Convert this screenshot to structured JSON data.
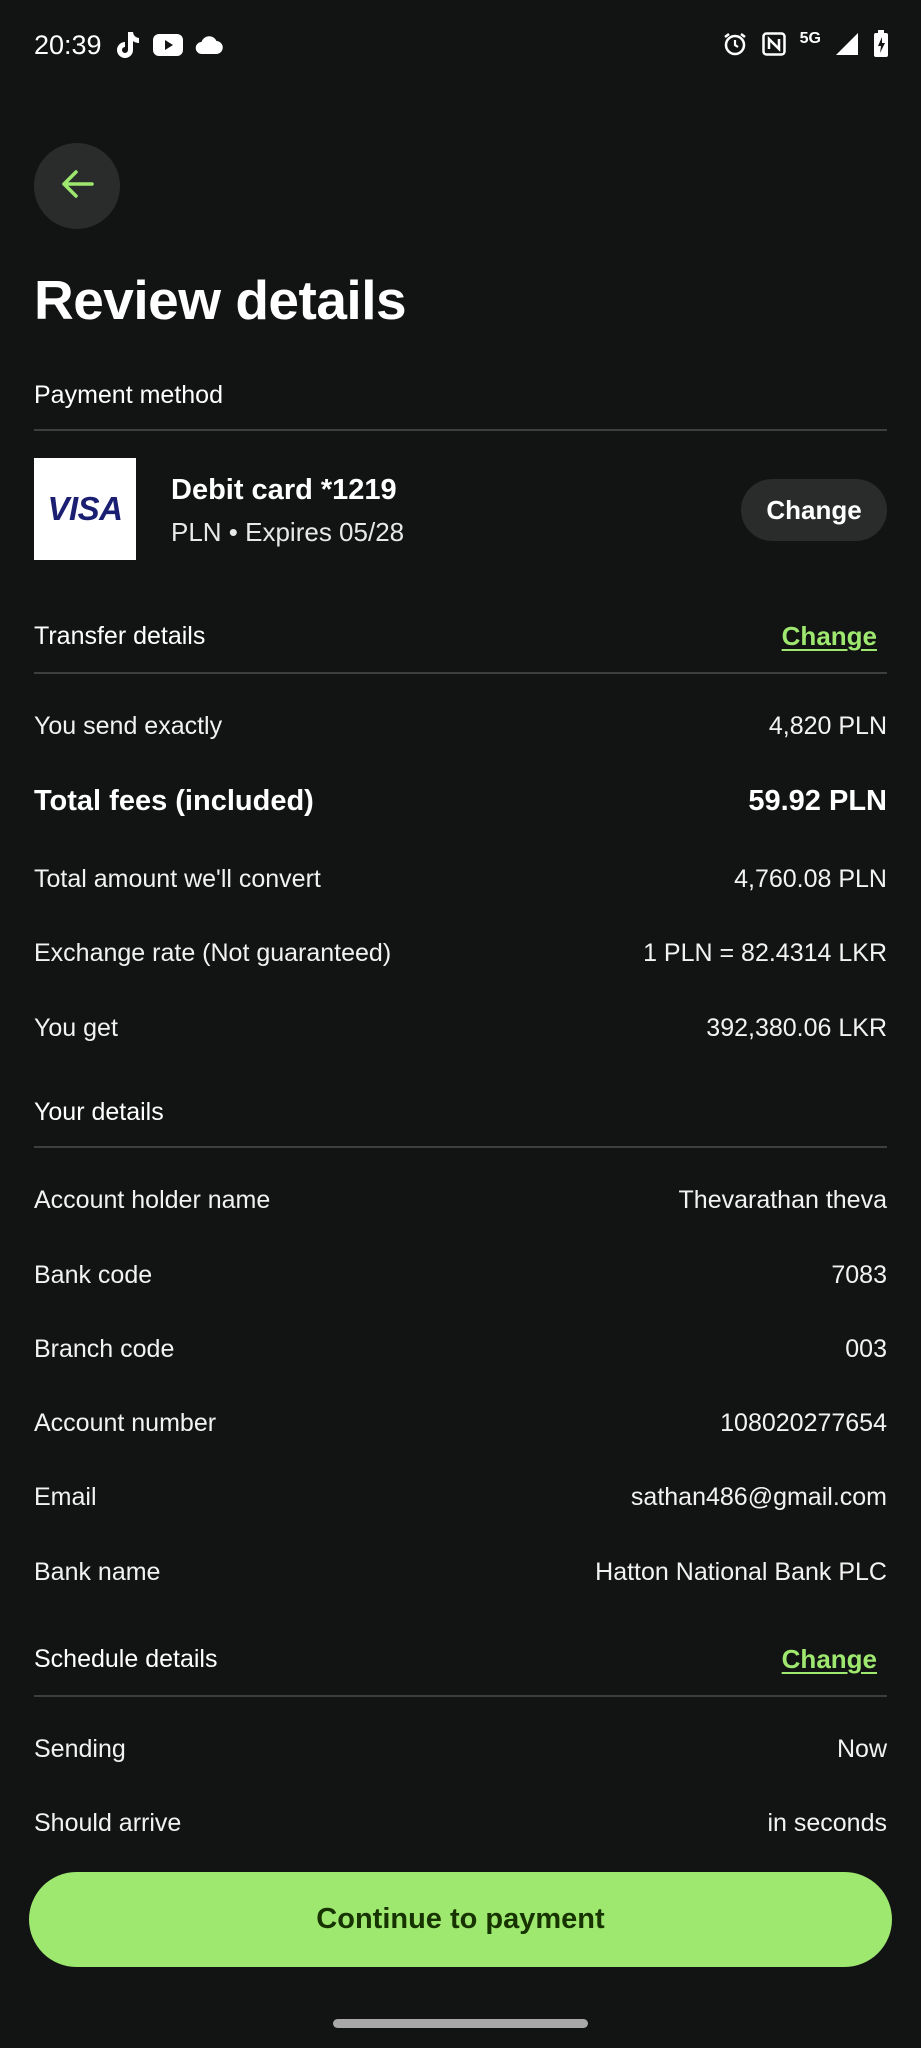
{
  "status_bar": {
    "time": "20:39",
    "left_icons": [
      "tiktok-icon",
      "youtube-icon",
      "cloud-icon"
    ],
    "right_icons": [
      "alarm-icon",
      "nfc-icon",
      "signal-icon",
      "battery-charging-icon"
    ],
    "network": "5G"
  },
  "header": {
    "back_icon": "arrow-left-icon",
    "title": "Review details"
  },
  "payment_method": {
    "section_title": "Payment method",
    "card_brand": "VISA",
    "card_title": "Debit card *1219",
    "card_subtitle": "PLN • Expires 05/28",
    "change_label": "Change"
  },
  "transfer_details": {
    "section_title": "Transfer details",
    "change_label": "Change",
    "rows": [
      {
        "label": "You send exactly",
        "value": "4,820 PLN"
      },
      {
        "label": "Total fees (included)",
        "value": "59.92 PLN"
      },
      {
        "label": "Total amount we'll convert",
        "value": "4,760.08 PLN"
      },
      {
        "label": "Exchange rate (Not guaranteed)",
        "value": "1 PLN = 82.4314 LKR"
      },
      {
        "label": "You get",
        "value": "392,380.06 LKR"
      }
    ]
  },
  "your_details": {
    "section_title": "Your details",
    "rows": [
      {
        "label": "Account holder name",
        "value": "Thevarathan theva"
      },
      {
        "label": "Bank code",
        "value": "7083"
      },
      {
        "label": "Branch code",
        "value": "003"
      },
      {
        "label": "Account number",
        "value": "108020277654"
      },
      {
        "label": "Email",
        "value": "sathan486@gmail.com"
      },
      {
        "label": "Bank name",
        "value": "Hatton National Bank PLC"
      }
    ]
  },
  "schedule_details": {
    "section_title": "Schedule details",
    "change_label": "Change",
    "rows": [
      {
        "label": "Sending",
        "value": "Now"
      },
      {
        "label": "Should arrive",
        "value": "in seconds"
      }
    ]
  },
  "footer": {
    "continue_label": "Continue to payment"
  },
  "colors": {
    "background": "#121413",
    "accent": "#9fe870",
    "accent_text": "#163300",
    "surface": "#2a2c2b"
  }
}
